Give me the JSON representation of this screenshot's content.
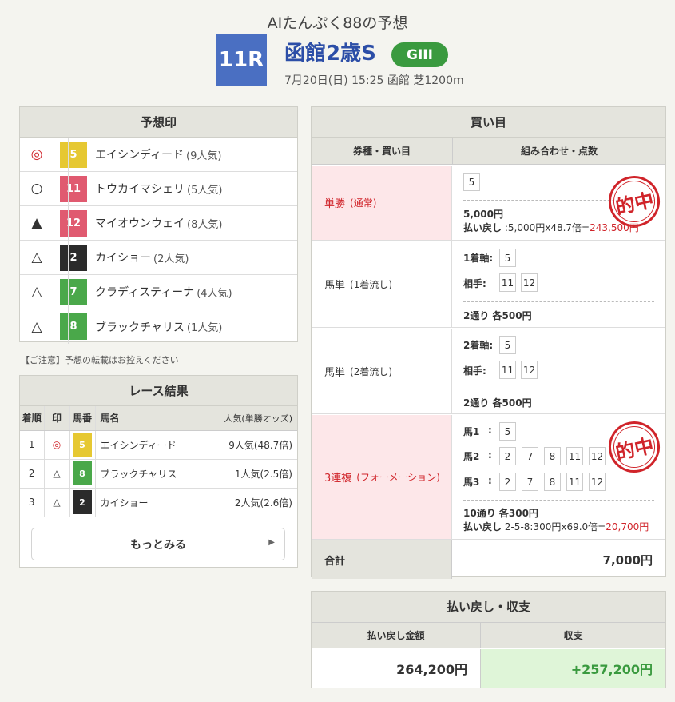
{
  "header": {
    "subtitle": "AIたんぷく88の予想",
    "race_number": "11R",
    "race_name": "函館2歳S",
    "grade": "GIII",
    "info": "7月20日(日) 15:25 函館 芝1200m"
  },
  "prediction": {
    "title": "予想印",
    "rows": [
      {
        "mark": "◎",
        "num": "5",
        "color": "#e6c832",
        "name": "エイシンディード",
        "pop": "(9人気)"
      },
      {
        "mark": "○",
        "num": "11",
        "color": "#e05a70",
        "name": "トウカイマシェリ",
        "pop": "(5人気)"
      },
      {
        "mark": "▲",
        "num": "12",
        "color": "#e05a70",
        "name": "マイオウンウェイ",
        "pop": "(8人気)"
      },
      {
        "mark": "△",
        "num": "2",
        "color": "#2b2b2b",
        "name": "カイショー",
        "pop": "(2人気)"
      },
      {
        "mark": "△",
        "num": "7",
        "color": "#4aa84a",
        "name": "クラディスティーナ",
        "pop": "(4人気)"
      },
      {
        "mark": "△",
        "num": "8",
        "color": "#4aa84a",
        "name": "ブラックチャリス",
        "pop": "(1人気)"
      }
    ],
    "notice": "【ご注意】予想の転載はお控えください"
  },
  "results": {
    "title": "レース結果",
    "headers": {
      "rank": "着順",
      "mark": "印",
      "num": "馬番",
      "name": "馬名",
      "pop": "人気(単勝オッズ)"
    },
    "rows": [
      {
        "rank": "1",
        "mark": "◎",
        "num": "5",
        "color": "#e6c832",
        "name": "エイシンディード",
        "pop": "9人気(48.7倍)"
      },
      {
        "rank": "2",
        "mark": "△",
        "num": "8",
        "color": "#4aa84a",
        "name": "ブラックチャリス",
        "pop": "1人気(2.5倍)"
      },
      {
        "rank": "3",
        "mark": "△",
        "num": "2",
        "color": "#2b2b2b",
        "name": "カイショー",
        "pop": "2人気(2.6倍)"
      }
    ],
    "more_label": "もっとみる"
  },
  "buy": {
    "title": "買い目",
    "col1": "券種・買い目",
    "col2": "組み合わせ・点数",
    "hit_stamp": "的中",
    "tansho": {
      "type": "単勝",
      "sub": "(通常)",
      "num": "5",
      "amount": "5,000円",
      "refund_label": "払い戻し",
      "refund_calc": ":5,000円x48.7倍=",
      "refund_total": "243,500円"
    },
    "umatan1": {
      "type": "馬単",
      "sub": "(1着流し)",
      "axis_label": "1着軸:",
      "axis": "5",
      "partner_label": "相手:",
      "partners": [
        "11",
        "12"
      ],
      "summary": "2通り 各500円"
    },
    "umatan2": {
      "type": "馬単",
      "sub": "(2着流し)",
      "axis_label": "2着軸:",
      "axis": "5",
      "partner_label": "相手:",
      "partners": [
        "11",
        "12"
      ],
      "summary": "2通り 各500円"
    },
    "sanrenpuku": {
      "type": "3連複",
      "sub": "(フォーメーション)",
      "h1_label": "馬1",
      "h1": [
        "5"
      ],
      "h2_label": "馬2",
      "h2": [
        "2",
        "7",
        "8",
        "11",
        "12"
      ],
      "h3_label": "馬3",
      "h3": [
        "2",
        "7",
        "8",
        "11",
        "12"
      ],
      "colon": ":",
      "summary": "10通り 各300円",
      "refund_label": "払い戻し",
      "refund_calc": "2-5-8:300円x69.0倍=",
      "refund_total": "20,700円"
    },
    "total_label": "合計",
    "total_value": "7,000円"
  },
  "payout": {
    "title": "払い戻し・収支",
    "col1": "払い戻し金額",
    "col2": "収支",
    "refund": "264,200円",
    "balance": "+257,200円"
  },
  "colors": {
    "accent_blue": "#4a6fc2",
    "grade_green": "#3a9a3f",
    "hit_red": "#d0242a",
    "profit_green": "#3a9a3f"
  }
}
